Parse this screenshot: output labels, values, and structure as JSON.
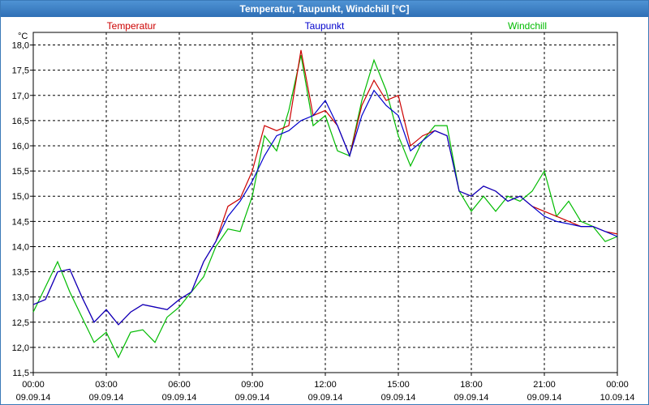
{
  "chart_data": {
    "type": "line",
    "title": "Temperatur, Taupunkt, Windchill [°C]",
    "ylabel": "°C",
    "ylim": [
      11.5,
      18.25
    ],
    "xlim": [
      "2014-09-09 00:00",
      "2014-09-10 00:00"
    ],
    "grid": true,
    "legend_position": "top",
    "y_ticks": [
      "11,5",
      "12,0",
      "12,5",
      "13,0",
      "13,5",
      "14,0",
      "14,5",
      "15,0",
      "15,5",
      "16,0",
      "16,5",
      "17,0",
      "17,5",
      "18,0"
    ],
    "x_ticks": [
      {
        "time": "00:00",
        "date": "09.09.14"
      },
      {
        "time": "03:00",
        "date": "09.09.14"
      },
      {
        "time": "06:00",
        "date": "09.09.14"
      },
      {
        "time": "09:00",
        "date": "09.09.14"
      },
      {
        "time": "12:00",
        "date": "09.09.14"
      },
      {
        "time": "15:00",
        "date": "09.09.14"
      },
      {
        "time": "18:00",
        "date": "09.09.14"
      },
      {
        "time": "21:00",
        "date": "09.09.14"
      },
      {
        "time": "00:00",
        "date": "10.09.14"
      }
    ],
    "x_hours": [
      0,
      0.5,
      1,
      1.5,
      2,
      2.5,
      3,
      3.5,
      4,
      4.5,
      5,
      5.5,
      6,
      6.5,
      7,
      7.5,
      8,
      8.5,
      9,
      9.5,
      10,
      10.5,
      11,
      11.5,
      12,
      12.5,
      13,
      13.5,
      14,
      14.5,
      15,
      15.5,
      16,
      16.5,
      17,
      17.5,
      18,
      18.5,
      19,
      19.5,
      20,
      20.5,
      21,
      21.5,
      22,
      22.5,
      23,
      23.5,
      24
    ],
    "series": [
      {
        "name": "Temperatur",
        "color": "#cc0000",
        "values": [
          12.85,
          12.95,
          13.5,
          13.55,
          13.0,
          12.5,
          12.75,
          12.45,
          12.7,
          12.85,
          12.8,
          12.75,
          12.95,
          13.1,
          13.7,
          14.1,
          14.8,
          14.95,
          15.5,
          16.4,
          16.3,
          16.4,
          17.9,
          16.6,
          16.7,
          16.4,
          15.8,
          16.8,
          17.3,
          16.9,
          17.0,
          16.0,
          16.2,
          16.3,
          16.2,
          15.1,
          15.0,
          15.2,
          15.1,
          14.9,
          15.0,
          14.8,
          14.7,
          14.6,
          14.5,
          14.4,
          14.4,
          14.3,
          14.25
        ]
      },
      {
        "name": "Taupunkt",
        "color": "#0000cc",
        "values": [
          12.85,
          12.95,
          13.5,
          13.55,
          13.0,
          12.5,
          12.75,
          12.45,
          12.7,
          12.85,
          12.8,
          12.75,
          12.95,
          13.1,
          13.7,
          14.1,
          14.6,
          14.9,
          15.3,
          15.8,
          16.2,
          16.3,
          16.5,
          16.6,
          16.9,
          16.4,
          15.8,
          16.6,
          17.1,
          16.8,
          16.6,
          15.9,
          16.1,
          16.3,
          16.2,
          15.1,
          15.0,
          15.2,
          15.1,
          14.9,
          15.0,
          14.8,
          14.6,
          14.5,
          14.45,
          14.4,
          14.4,
          14.3,
          14.2
        ]
      },
      {
        "name": "Windchill",
        "color": "#00bb00",
        "values": [
          12.7,
          13.2,
          13.7,
          13.1,
          12.6,
          12.1,
          12.3,
          11.8,
          12.3,
          12.35,
          12.1,
          12.6,
          12.8,
          13.1,
          13.4,
          14.0,
          14.35,
          14.3,
          15.0,
          16.2,
          15.9,
          16.7,
          17.8,
          16.4,
          16.6,
          15.9,
          15.8,
          16.9,
          17.7,
          17.1,
          16.2,
          15.6,
          16.1,
          16.4,
          16.4,
          15.1,
          14.7,
          15.0,
          14.7,
          15.0,
          14.9,
          15.1,
          15.5,
          14.6,
          14.9,
          14.5,
          14.4,
          14.1,
          14.2
        ]
      }
    ]
  }
}
